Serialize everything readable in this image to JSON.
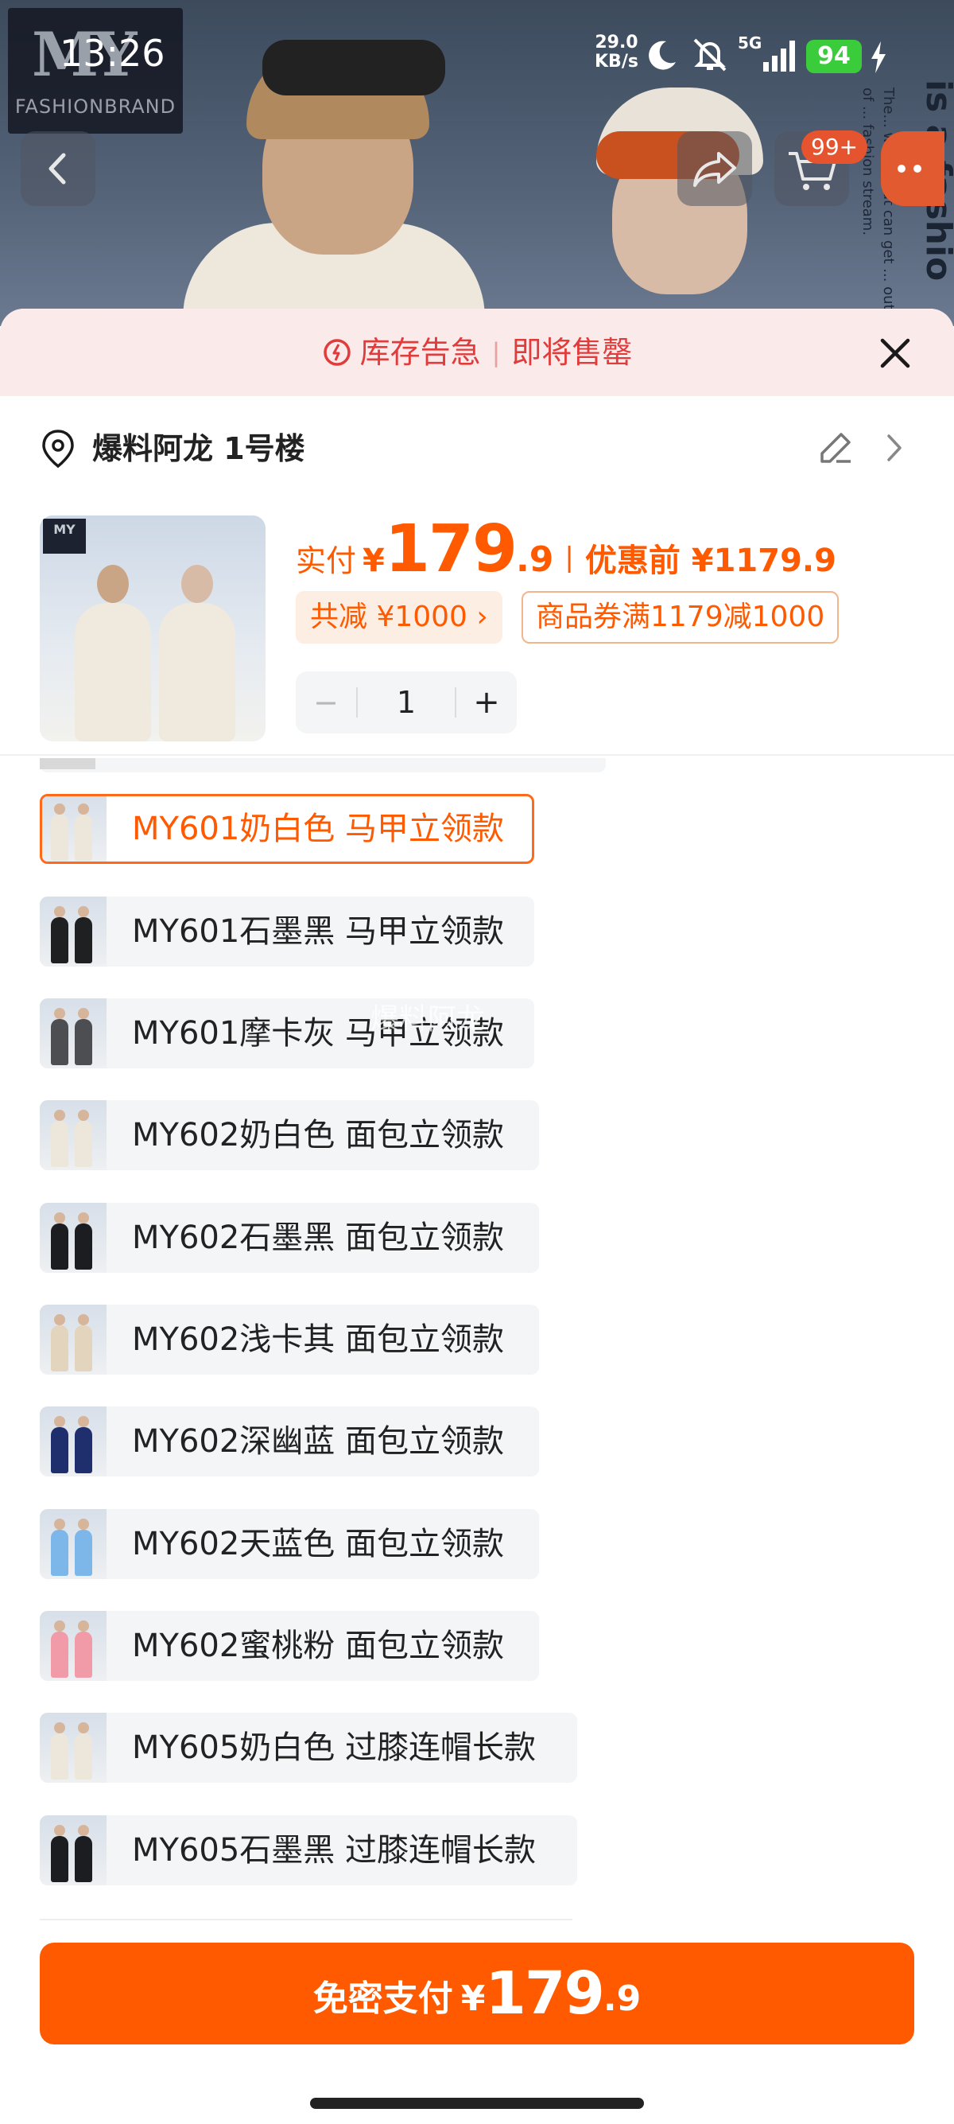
{
  "status_bar": {
    "time": "13:26",
    "net_speed_value": "29.0",
    "net_speed_unit": "KB/s",
    "network": "5G",
    "battery": "94",
    "icons": [
      "moon-icon",
      "mute-bell-icon",
      "signal-icon",
      "charging-bolt-icon"
    ]
  },
  "brand": {
    "mark": "MY",
    "name": "FASHIONBRAND"
  },
  "banner": {
    "vertical_text": "The... world that can get ... out of ... fashion stream.",
    "big_text": "is a fashio"
  },
  "top_nav": {
    "cart_badge": "99+"
  },
  "sheet": {
    "alert": {
      "left": "库存告急",
      "separator": "|",
      "right": "即将售罄"
    },
    "address": "爆料阿龙 1号楼",
    "price": {
      "label": "实付",
      "currency": "¥",
      "int": "179",
      "dec": ".9",
      "separator": "|",
      "original": "优惠前 ¥1179.9"
    },
    "discount": "共减 ¥1000 ›",
    "coupon": "商品券满1179减1000",
    "quantity": {
      "minus": "−",
      "value": "1",
      "plus": "+"
    }
  },
  "variants": [
    {
      "label": "MY601奶白色 马甲立领款",
      "selected": true
    },
    {
      "label": "MY601石墨黑 马甲立领款",
      "selected": false
    },
    {
      "label": "MY601摩卡灰 马甲立领款",
      "selected": false
    },
    {
      "label": "MY602奶白色 面包立领款",
      "selected": false
    },
    {
      "label": "MY602石墨黑 面包立领款",
      "selected": false
    },
    {
      "label": "MY602浅卡其 面包立领款",
      "selected": false
    },
    {
      "label": "MY602深幽蓝 面包立领款",
      "selected": false
    },
    {
      "label": "MY602天蓝色 面包立领款",
      "selected": false
    },
    {
      "label": "MY602蜜桃粉 面包立领款",
      "selected": false
    },
    {
      "label": "MY605奶白色 过膝连帽长款",
      "selected": false
    },
    {
      "label": "MY605石墨黑 过膝连帽长款",
      "selected": false
    }
  ],
  "watermark": "爆料阿龙",
  "pay_button": {
    "label": "免密支付",
    "currency": "¥",
    "int": "179",
    "dec": ".9"
  },
  "colors": {
    "accent": "#ff5a00",
    "alert_red": "#e03c3c",
    "alert_bg": "#fbeaea",
    "battery_green": "#3bcc3b"
  }
}
